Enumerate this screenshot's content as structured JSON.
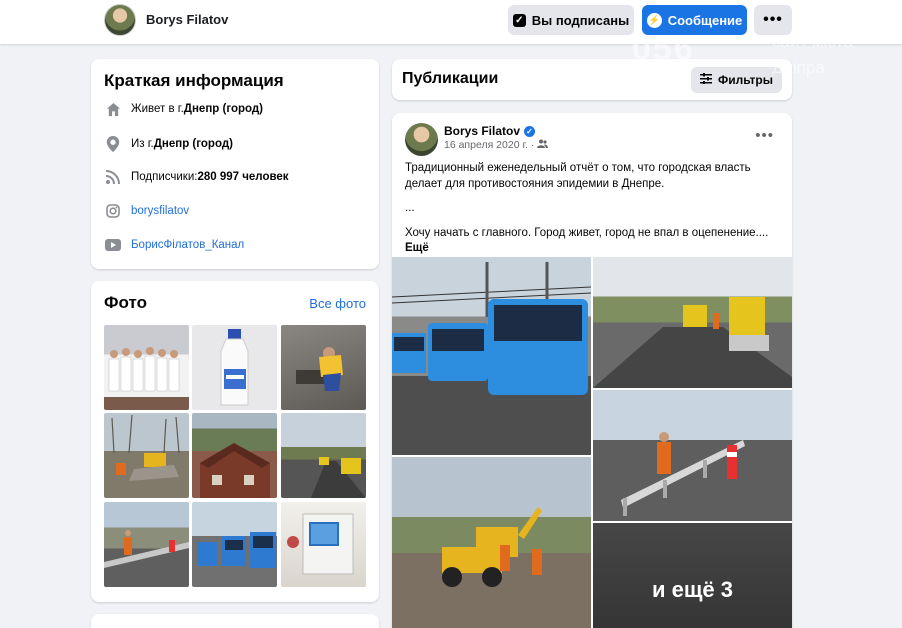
{
  "header": {
    "name": "Borys Filatov",
    "subscribed_label": "Вы подписаны",
    "message_label": "Сообщение",
    "more_label": "•••"
  },
  "watermark": {
    "logo": "056",
    "line1": "сайт міста",
    "line2": "Дніпра"
  },
  "intro": {
    "title": "Краткая информация",
    "lives_prefix": "Живет в г. ",
    "lives_city": "Днепр (город)",
    "from_prefix": "Из г. ",
    "from_city": "Днепр (город)",
    "followers_prefix": "Подписчики: ",
    "followers_count": "280 997 человек",
    "instagram": "borysfilatov",
    "youtube": "БорисФілатов_Канал"
  },
  "photos": {
    "title": "Фото",
    "all_link": "Все фото"
  },
  "publications": {
    "title": "Публикации",
    "filter_label": "Фильтры"
  },
  "post": {
    "author": "Borys Filatov",
    "date": "16 апреля 2020 г. ·",
    "more": "•••",
    "para1": "Традиционный еженедельный отчёт о том, что городская власть делает для противостояния эпидемии в Днепре.",
    "para2": "...",
    "para3": "Хочу начать с главного. Город живет, город не впал в оцепенение....",
    "see_more": "Ещё",
    "more_photos": "и ещё 3"
  },
  "colors": {
    "accent": "#1b74e4",
    "link": "#216fdb",
    "background": "#f0f2f5"
  }
}
